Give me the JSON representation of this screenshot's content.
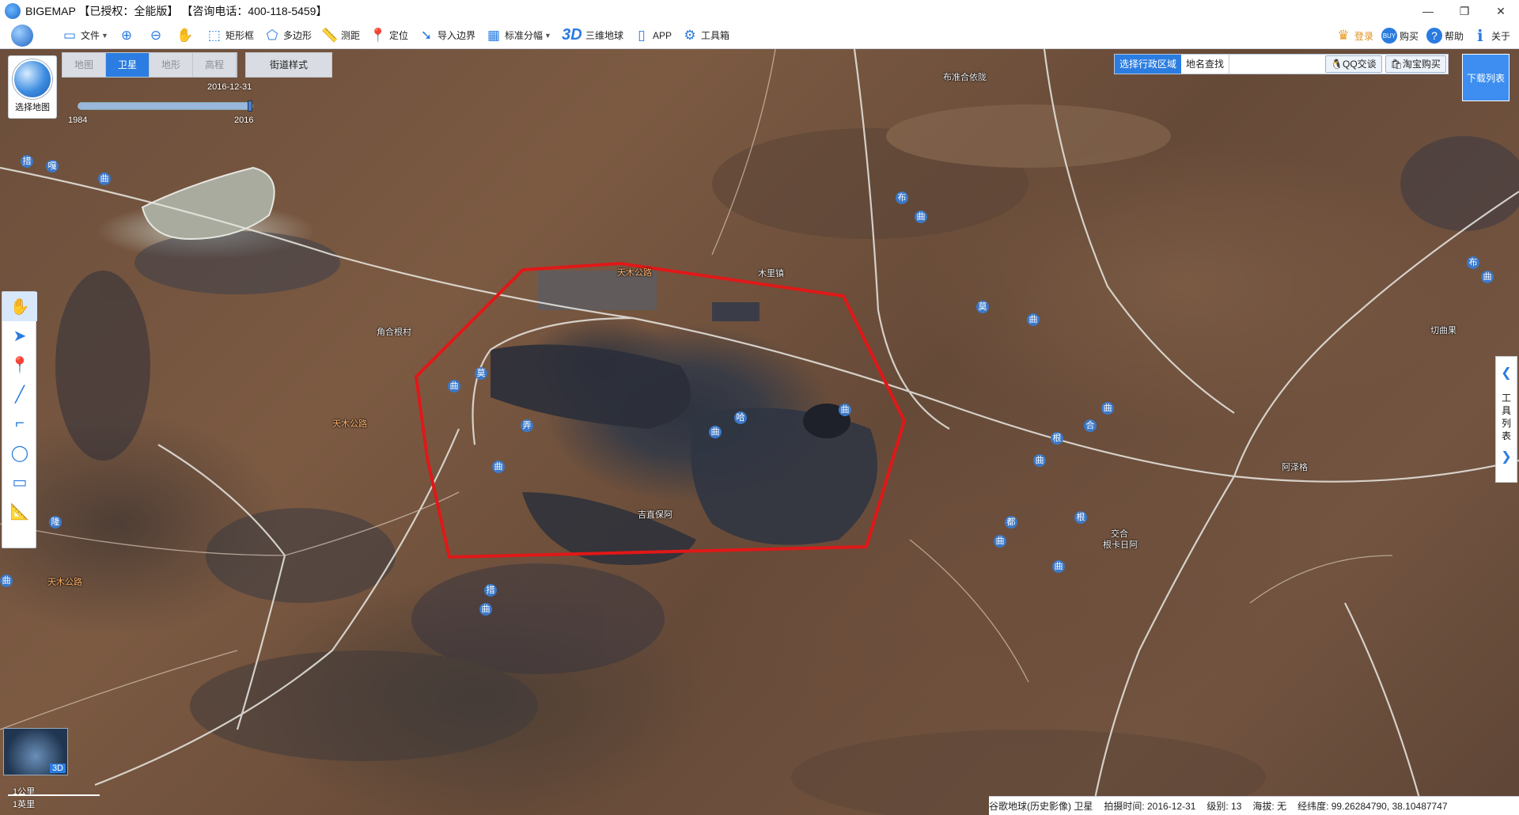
{
  "window": {
    "title": "BIGEMAP 【已授权：全能版】 【咨询电话：400-118-5459】",
    "controls": {
      "minimize": "—",
      "maximize": "❐",
      "close": "✕"
    }
  },
  "toolbar": {
    "file": "文件",
    "zoom_in": "⊕",
    "zoom_out": "⊖",
    "pan": "✋",
    "rectangle": "矩形框",
    "polygon": "多边形",
    "measure": "测距",
    "locate": "定位",
    "import_boundary": "导入边界",
    "standard_grid": "标准分幅",
    "3d_label": "3D",
    "globe_3d": "三维地球",
    "app": "APP",
    "toolbox": "工具箱",
    "login": "登录",
    "buy": "购买",
    "help": "帮助",
    "about": "关于"
  },
  "map_panel": {
    "select_map": "选择地图",
    "tabs": [
      {
        "label": "地图",
        "active": false
      },
      {
        "label": "卫星",
        "active": true
      },
      {
        "label": "地形",
        "active": false
      },
      {
        "label": "高程",
        "active": false
      }
    ],
    "street_style": "街道样式",
    "timeline": {
      "current": "2016-12-31",
      "start": "1984",
      "end": "2016",
      "position": 1.0
    }
  },
  "admin_panel": {
    "select_region": "选择行政区域",
    "place_search": "地名查找",
    "qq": "QQ交谈",
    "taobao": "淘宝购买",
    "download_list": "下载列表"
  },
  "right_tools": {
    "label": "工具列表"
  },
  "scale": {
    "metric": "1公里",
    "imperial": "1英里",
    "badge_3d": "3D"
  },
  "status": {
    "source": "谷歌地球(历史影像) 卫星",
    "capture_time": "拍摄时间: 2016-12-31",
    "level": "级别:  13",
    "altitude": "海拔: 无",
    "coords": "经纬度:  99.26284790, 38.10487747"
  },
  "places": {
    "bu_zhun": "布准合依陇",
    "mu_li_zhen": "木里镇",
    "jiao_he_gen": "角合根村",
    "tian_mu_gonglu": "天木公路",
    "tian_mu_gonglu_2": "天木公路",
    "tian_mu_gonglu_3": "天木公路",
    "qie_ci": "切曲果",
    "he_ze_ge": "阿泽格",
    "ji_zhi": "吉直保阿",
    "jiao_he": "交合",
    "gen_ka": "根卡日阿"
  },
  "road_marks": [
    "措",
    "嘎",
    "曲",
    "布",
    "曲",
    "莫",
    "曲",
    "莫",
    "曲",
    "曲",
    "根",
    "曲",
    "合",
    "曲",
    "弄",
    "曲",
    "都",
    "曲",
    "哈",
    "曲",
    "隆",
    "曲",
    "布",
    "曲",
    "根",
    "曲",
    "措",
    "曲"
  ]
}
